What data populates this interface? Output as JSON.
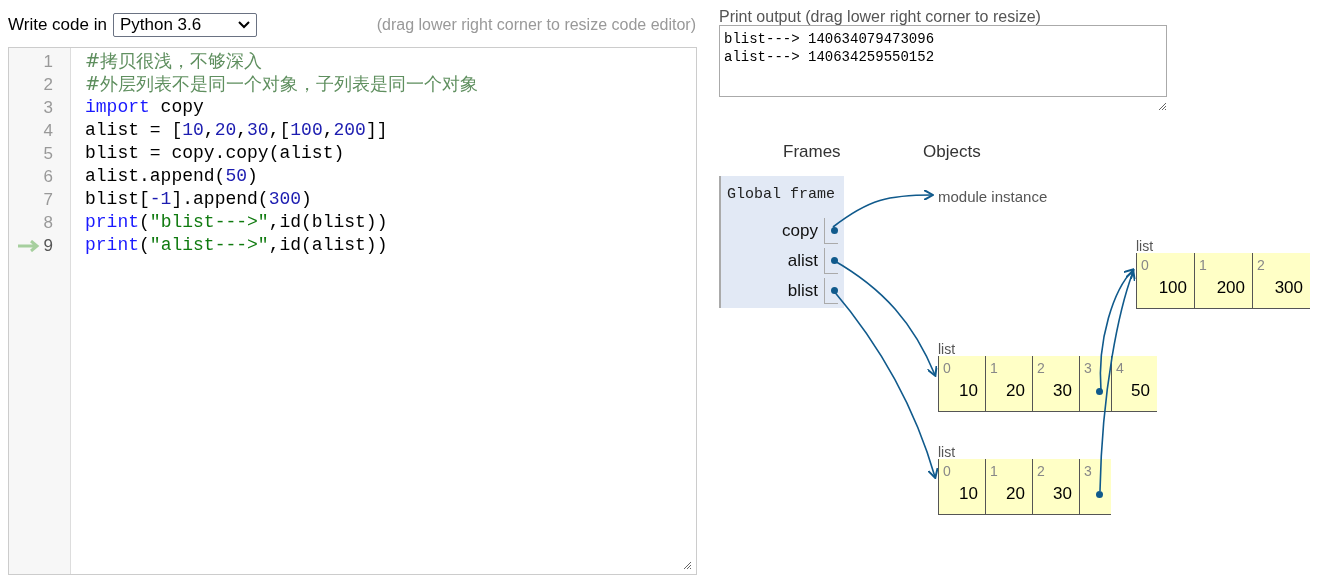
{
  "editor": {
    "label": "Write code in",
    "language": "Python 3.6",
    "hint": "(drag lower right corner to resize code editor)",
    "lines": [
      {
        "number": "1",
        "current": false,
        "tokens": [
          {
            "kind": "comment",
            "text": "#拷贝很浅，不够深入"
          }
        ]
      },
      {
        "number": "2",
        "current": false,
        "tokens": [
          {
            "kind": "comment",
            "text": "#外层列表不是同一个对象，子列表是同一个对象"
          }
        ]
      },
      {
        "number": "3",
        "current": false,
        "tokens": [
          {
            "kind": "keyword",
            "text": "import"
          },
          {
            "kind": "plain",
            "text": " copy"
          }
        ]
      },
      {
        "number": "4",
        "current": false,
        "tokens": [
          {
            "kind": "plain",
            "text": "alist = ["
          },
          {
            "kind": "number",
            "text": "10"
          },
          {
            "kind": "plain",
            "text": ","
          },
          {
            "kind": "number",
            "text": "20"
          },
          {
            "kind": "plain",
            "text": ","
          },
          {
            "kind": "number",
            "text": "30"
          },
          {
            "kind": "plain",
            "text": ",["
          },
          {
            "kind": "number",
            "text": "100"
          },
          {
            "kind": "plain",
            "text": ","
          },
          {
            "kind": "number",
            "text": "200"
          },
          {
            "kind": "plain",
            "text": "]]"
          }
        ]
      },
      {
        "number": "5",
        "current": false,
        "tokens": [
          {
            "kind": "plain",
            "text": "blist = copy.copy(alist)"
          }
        ]
      },
      {
        "number": "6",
        "current": false,
        "tokens": [
          {
            "kind": "plain",
            "text": "alist.append("
          },
          {
            "kind": "number",
            "text": "50"
          },
          {
            "kind": "plain",
            "text": ")"
          }
        ]
      },
      {
        "number": "7",
        "current": false,
        "tokens": [
          {
            "kind": "plain",
            "text": "blist["
          },
          {
            "kind": "number",
            "text": "-1"
          },
          {
            "kind": "plain",
            "text": "].append("
          },
          {
            "kind": "number",
            "text": "300"
          },
          {
            "kind": "plain",
            "text": ")"
          }
        ]
      },
      {
        "number": "8",
        "current": false,
        "tokens": [
          {
            "kind": "keyword",
            "text": "print"
          },
          {
            "kind": "plain",
            "text": "("
          },
          {
            "kind": "string",
            "text": "\"blist--->\""
          },
          {
            "kind": "plain",
            "text": ",id(blist))"
          }
        ]
      },
      {
        "number": "9",
        "current": true,
        "tokens": [
          {
            "kind": "keyword",
            "text": "print"
          },
          {
            "kind": "plain",
            "text": "("
          },
          {
            "kind": "string",
            "text": "\"alist--->\""
          },
          {
            "kind": "plain",
            "text": ",id(alist))"
          }
        ]
      }
    ]
  },
  "output": {
    "label": "Print output (drag lower right corner to resize)",
    "lines": [
      "blist---> 140634079473096",
      "alist---> 140634259550152"
    ]
  },
  "visualization": {
    "frames_heading": "Frames",
    "objects_heading": "Objects",
    "frame": {
      "title": "Global frame",
      "variables": [
        {
          "name": "copy"
        },
        {
          "name": "alist"
        },
        {
          "name": "blist"
        }
      ]
    },
    "module": {
      "label": "module instance"
    },
    "objects": [
      {
        "type": "list",
        "items": [
          {
            "kind": "value",
            "index": "0",
            "value": "100"
          },
          {
            "kind": "value",
            "index": "1",
            "value": "200"
          },
          {
            "kind": "value",
            "index": "2",
            "value": "300"
          }
        ]
      },
      {
        "type": "list",
        "items": [
          {
            "kind": "value",
            "index": "0",
            "value": "10"
          },
          {
            "kind": "value",
            "index": "1",
            "value": "20"
          },
          {
            "kind": "value",
            "index": "2",
            "value": "30"
          },
          {
            "kind": "pointer",
            "index": "3"
          },
          {
            "kind": "value",
            "index": "4",
            "value": "50"
          }
        ]
      },
      {
        "type": "list",
        "items": [
          {
            "kind": "value",
            "index": "0",
            "value": "10"
          },
          {
            "kind": "value",
            "index": "1",
            "value": "20"
          },
          {
            "kind": "value",
            "index": "2",
            "value": "30"
          },
          {
            "kind": "pointer",
            "index": "3"
          }
        ]
      }
    ]
  }
}
